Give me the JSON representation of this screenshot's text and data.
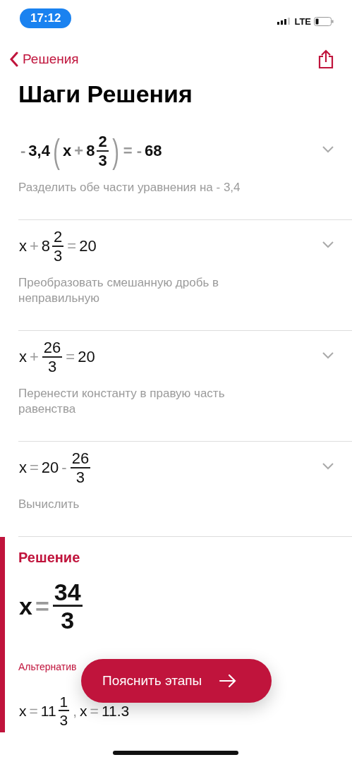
{
  "status_bar": {
    "time": "17:12",
    "network": "LTE"
  },
  "nav": {
    "back_label": "Решения"
  },
  "title": "Шаги Решения",
  "steps": [
    {
      "bold": true,
      "expanded": false,
      "expression": [
        {
          "kind": "op",
          "text": "-"
        },
        {
          "kind": "sym",
          "text": "3,4"
        },
        {
          "kind": "paren",
          "text": "("
        },
        {
          "kind": "sym",
          "text": "x"
        },
        {
          "kind": "op",
          "text": "+"
        },
        {
          "kind": "sym",
          "text": "8"
        },
        {
          "kind": "frac",
          "num": "2",
          "den": "3"
        },
        {
          "kind": "paren",
          "text": ")"
        },
        {
          "kind": "op",
          "text": "="
        },
        {
          "kind": "op",
          "text": "-"
        },
        {
          "kind": "sym",
          "text": "68"
        }
      ],
      "description": "Разделить обе части уравнения на - 3,4"
    },
    {
      "bold": false,
      "expanded": false,
      "expression": [
        {
          "kind": "sym",
          "text": "x"
        },
        {
          "kind": "op",
          "text": "+"
        },
        {
          "kind": "sym",
          "text": "8"
        },
        {
          "kind": "frac",
          "num": "2",
          "den": "3"
        },
        {
          "kind": "op",
          "text": "="
        },
        {
          "kind": "sym",
          "text": "20"
        }
      ],
      "description": "Преобразовать смешанную дробь в неправильную"
    },
    {
      "bold": false,
      "expanded": false,
      "expression": [
        {
          "kind": "sym",
          "text": "x"
        },
        {
          "kind": "op",
          "text": "+"
        },
        {
          "kind": "frac",
          "num": "26",
          "den": "3"
        },
        {
          "kind": "op",
          "text": "="
        },
        {
          "kind": "sym",
          "text": "20"
        }
      ],
      "description": "Перенести константу в правую часть равенства"
    },
    {
      "bold": false,
      "expanded": false,
      "expression": [
        {
          "kind": "sym",
          "text": "x"
        },
        {
          "kind": "op",
          "text": "="
        },
        {
          "kind": "sym",
          "text": "20"
        },
        {
          "kind": "op",
          "text": "-"
        },
        {
          "kind": "frac",
          "num": "26",
          "den": "3"
        }
      ],
      "description": "Вычислить"
    }
  ],
  "solution": {
    "heading": "Решение",
    "answer": [
      {
        "kind": "sym",
        "text": "x"
      },
      {
        "kind": "op",
        "text": "="
      },
      {
        "kind": "frac",
        "num": "34",
        "den": "3"
      }
    ],
    "alternative_label": "Альтернатив",
    "alternative": [
      {
        "kind": "sym",
        "text": "x"
      },
      {
        "kind": "op",
        "text": "="
      },
      {
        "kind": "sym",
        "text": "11"
      },
      {
        "kind": "frac",
        "num": "1",
        "den": "3"
      },
      {
        "kind": "op",
        "text": ","
      },
      {
        "kind": "sym",
        "text": "x"
      },
      {
        "kind": "op",
        "text": "="
      },
      {
        "kind": "sym",
        "text": "11.3"
      }
    ]
  },
  "action_button": {
    "label": "Пояснить этапы"
  }
}
